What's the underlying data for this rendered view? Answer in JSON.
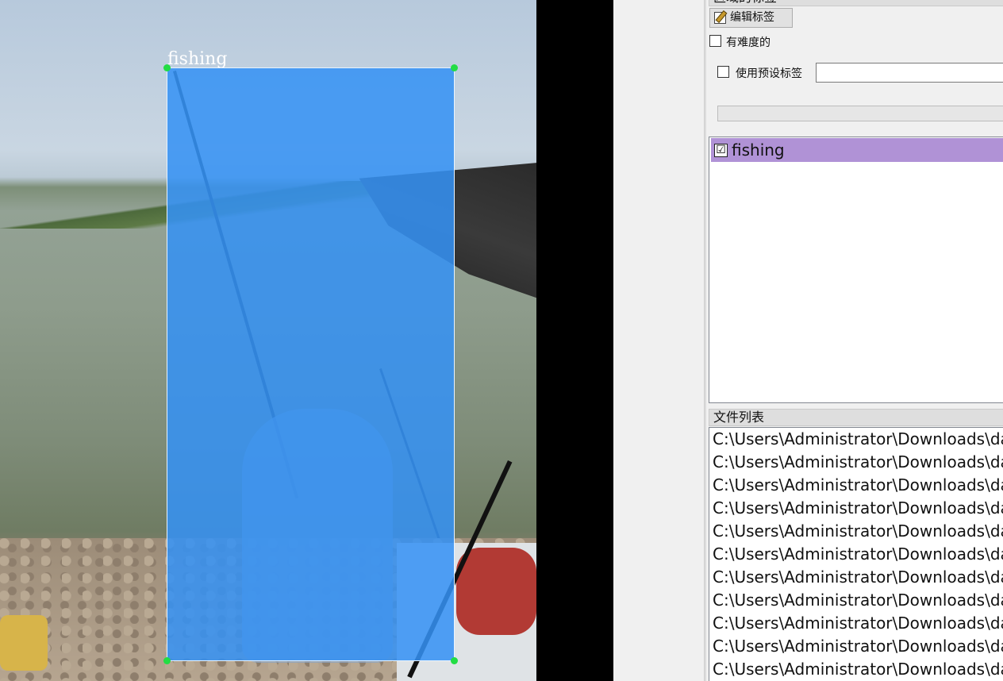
{
  "canvas": {
    "annotation": {
      "label": "fishing",
      "color": "#3492f5",
      "handle_color": "#22dd44"
    }
  },
  "box_labels_dock": {
    "title": "区域的标签",
    "edit_button": "编辑标签",
    "edit_icon": "edit-pencil-icon",
    "difficult_checkbox": {
      "label": "有难度的",
      "checked": false
    },
    "use_preset_checkbox": {
      "label": "使用预设标签",
      "checked": false
    },
    "preset_input": {
      "value": "",
      "placeholder": ""
    },
    "labels": [
      {
        "text": "fishing",
        "checked": true,
        "mark": "☑",
        "highlight": "#b092d6"
      }
    ]
  },
  "file_list_dock": {
    "title": "文件列表",
    "files": [
      "C:\\Users\\Administrator\\Downloads\\dat",
      "C:\\Users\\Administrator\\Downloads\\dat",
      "C:\\Users\\Administrator\\Downloads\\dat",
      "C:\\Users\\Administrator\\Downloads\\dat",
      "C:\\Users\\Administrator\\Downloads\\dat",
      "C:\\Users\\Administrator\\Downloads\\dat",
      "C:\\Users\\Administrator\\Downloads\\dat",
      "C:\\Users\\Administrator\\Downloads\\dat",
      "C:\\Users\\Administrator\\Downloads\\dat",
      "C:\\Users\\Administrator\\Downloads\\dat",
      "C:\\Users\\Administrator\\Downloads\\dat"
    ]
  }
}
